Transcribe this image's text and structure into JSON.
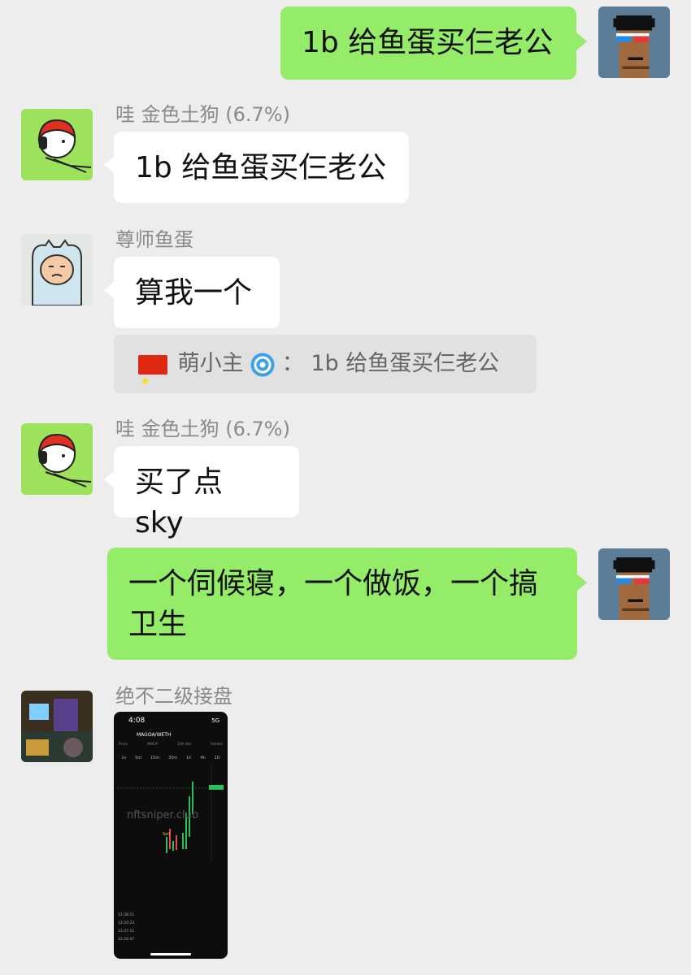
{
  "messages": {
    "m1": {
      "text": "1b 给鱼蛋买仨老公"
    },
    "m2": {
      "sender": "哇 金色土狗 (6.7%)",
      "text": "1b 给鱼蛋买仨老公"
    },
    "m3": {
      "sender": "尊师鱼蛋",
      "text": "算我一个"
    },
    "quote": {
      "name": "萌小主",
      "separator": "：",
      "text": "1b 给鱼蛋买仨老公"
    },
    "m4": {
      "sender": "哇 金色土狗 (6.7%)",
      "text": "买了点 sky"
    },
    "m5": {
      "text_line1": "一个伺候寝，一个做饭，一个搞",
      "text_line2": "卫生"
    },
    "m6": {
      "sender": "绝不二级接盘"
    }
  },
  "screenshot": {
    "time": "4:08",
    "network": "5G",
    "pair": "MAGOA/WETH",
    "stats": [
      "Price",
      "MACP",
      "24h Vol",
      "Holder"
    ],
    "timeframes": [
      "1s",
      "5m",
      "15m",
      "30m",
      "1h",
      "4h",
      "1D"
    ],
    "watermark": "nftsniper.club",
    "sell_label": "Sell",
    "tx_times": [
      "12:38:11",
      "12:33:23",
      "12:27:11",
      "12:24:47"
    ]
  },
  "colors": {
    "self_bubble": "#95ec69",
    "other_bubble": "#ffffff",
    "background": "#ededed"
  },
  "icons": [
    "china-flag-icon",
    "swirl-icon"
  ]
}
